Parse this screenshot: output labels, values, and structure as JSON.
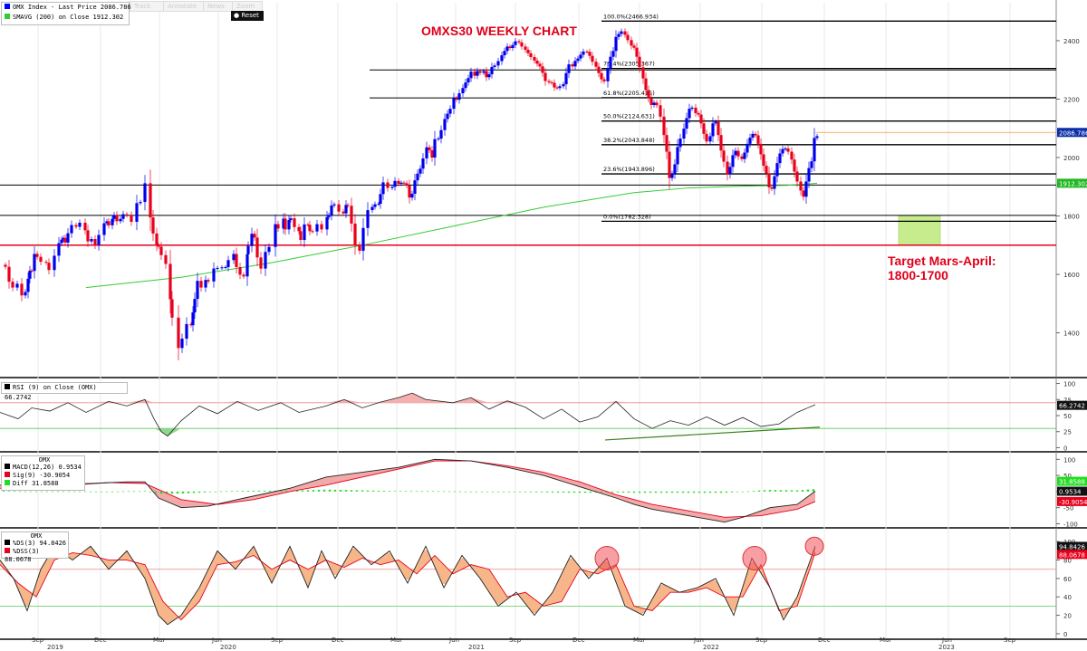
{
  "toolbar": {
    "track_label": "Track",
    "annotate_label": "Annotate",
    "news_label": "News",
    "zoom_label": "Zoom",
    "reset_label": "Reset"
  },
  "legend": {
    "price_label": "OMX Index - Last Price 2086.786",
    "smavg_label": "SMAVG (200)  on Close  1912.302",
    "price_color": "#0000ff",
    "smavg_color": "#33cc33"
  },
  "title": "OMXS30 WEEKLY CHART",
  "target_text": [
    "Target Mars-April:",
    "1800-1700"
  ],
  "colors": {
    "up": "#0000ee",
    "down": "#e8001c",
    "sma": "#33cc33",
    "hline_red": "#e8001c",
    "rsi": "#222222",
    "accent_red": "#e8001c",
    "target_box": "#c6ec8e"
  },
  "x_axis": {
    "months": [
      "Sep",
      "Dec",
      "Mar",
      "Jun",
      "Sep",
      "Dec",
      "Mar",
      "Jun",
      "Sep",
      "Dec",
      "Mar",
      "Jun",
      "Sep",
      "Dec",
      "Mar",
      "Jun",
      "Sep"
    ],
    "years": [
      "2019",
      "2020",
      "2021",
      "2022",
      "2023"
    ]
  },
  "chart_data": [
    {
      "type": "candlestick",
      "title": "OMXS30 WEEKLY CHART",
      "ylim": [
        1250,
        2530
      ],
      "y_ticks": [
        1400,
        1600,
        1800,
        2000,
        2200,
        2400
      ],
      "last_price_label": "2086.786",
      "sma_last_label": "1912.302",
      "price_path_x": [
        0,
        6,
        10,
        14,
        19,
        24,
        28,
        31,
        33,
        35,
        38,
        41,
        45,
        51,
        54,
        60,
        65,
        68,
        70,
        72,
        75,
        79,
        84,
        88,
        94,
        97,
        101,
        105,
        109,
        115,
        118,
        120,
        124,
        126,
        129,
        133,
        136,
        140,
        145,
        151,
        155,
        160,
        166,
        169,
        173,
        175,
        178,
        183,
        188,
        190,
        197,
        201,
        206,
        211,
        213,
        215,
        218,
        222,
        227,
        230,
        236,
        240,
        245,
        249,
        252,
        258,
        261,
        265,
        269,
        273,
        274,
        278,
        281,
        284,
        288,
        293,
        297,
        304,
        307,
        313,
        315,
        319,
        321,
        325,
        330,
        332,
        336,
        340,
        342,
        345,
        350,
        355,
        361,
        363,
        366,
        369,
        374,
        379,
        382,
        384,
        388,
        392,
        397,
        401,
        406,
        411,
        414,
        418,
        420,
        423,
        428,
        433,
        436,
        440,
        443,
        446,
        449,
        452,
        455,
        458,
        461,
        464,
        467,
        471,
        474,
        477,
        480,
        484,
        487,
        491,
        494,
        497,
        501,
        504,
        507,
        511,
        514,
        517,
        520,
        524,
        527,
        530,
        534,
        537,
        540,
        543,
        546,
        550,
        554,
        557,
        560,
        563,
        566,
        569,
        573,
        576,
        580,
        583,
        586,
        590,
        593,
        596,
        599,
        602,
        606,
        609,
        612,
        615,
        618,
        622,
        625,
        628,
        632,
        635,
        638,
        641,
        644,
        648,
        651,
        654,
        658,
        661,
        664,
        667,
        671,
        674,
        677,
        680,
        683,
        686,
        690,
        693,
        697,
        700,
        703,
        706,
        710,
        713,
        716,
        719,
        722,
        725,
        729,
        733,
        736,
        739,
        742,
        745,
        748,
        751,
        755,
        758,
        761,
        764,
        768,
        771,
        774,
        777,
        780,
        784,
        787,
        790,
        793,
        796,
        799,
        803,
        806,
        809,
        812,
        815,
        819,
        822,
        825,
        828,
        831,
        834,
        837,
        840,
        843,
        846,
        849,
        852,
        855,
        858,
        861,
        864,
        867,
        870,
        874,
        877,
        880,
        884,
        887,
        890,
        893,
        896,
        899,
        902
      ],
      "price_path_y": [
        1633,
        1626,
        1575,
        1555,
        1568,
        1528,
        1540,
        1585,
        1613,
        1612,
        1670,
        1660,
        1643,
        1640,
        1615,
        1664,
        1707,
        1719,
        1725,
        1709,
        1741,
        1769,
        1763,
        1777,
        1751,
        1713,
        1721,
        1700,
        1735,
        1775,
        1782,
        1768,
        1790,
        1803,
        1782,
        1790,
        1806,
        1802,
        1780,
        1844,
        1848,
        1912,
        1795,
        1740,
        1700,
        1695,
        1666,
        1636,
        1515,
        1452,
        1348,
        1380,
        1430,
        1426,
        1470,
        1516,
        1578,
        1555,
        1581,
        1576,
        1620,
        1622,
        1624,
        1625,
        1649,
        1670,
        1625,
        1599,
        1593,
        1669,
        1697,
        1739,
        1726,
        1658,
        1620,
        1677,
        1694,
        1772,
        1757,
        1791,
        1754,
        1786,
        1792,
        1762,
        1748,
        1718,
        1771,
        1770,
        1748,
        1747,
        1772,
        1754,
        1796,
        1803,
        1836,
        1840,
        1815,
        1809,
        1838,
        1835,
        1774,
        1699,
        1681,
        1759,
        1820,
        1831,
        1840,
        1842,
        1875,
        1915,
        1896,
        1900,
        1920,
        1910,
        1914,
        1912,
        1904,
        1863,
        1876,
        1922,
        1945,
        1962,
        1997,
        2035,
        2025,
        2000,
        2063,
        2065,
        2094,
        2132,
        2150,
        2167,
        2203,
        2198,
        2220,
        2238,
        2257,
        2272,
        2294,
        2280,
        2296,
        2290,
        2296,
        2275,
        2285,
        2310,
        2315,
        2330,
        2350,
        2365,
        2380,
        2375,
        2385,
        2398,
        2394,
        2380,
        2369,
        2357,
        2344,
        2332,
        2321,
        2312,
        2290,
        2262,
        2258,
        2256,
        2240,
        2238,
        2244,
        2251,
        2289,
        2319,
        2312,
        2331,
        2339,
        2352,
        2363,
        2362,
        2348,
        2328,
        2311,
        2289,
        2268,
        2261,
        2306,
        2345,
        2365,
        2413,
        2423,
        2432,
        2420,
        2402,
        2383,
        2376,
        2345,
        2309,
        2271,
        2231,
        2204,
        2180,
        2188,
        2179,
        2140,
        2077,
        2020,
        1930,
        1944,
        1977,
        2036,
        2065,
        2099,
        2135,
        2167,
        2171,
        2152,
        2147,
        2117,
        2081,
        2055,
        2073,
        2117,
        2122,
        2077,
        2024,
        1986,
        1943,
        1968,
        2008,
        2023,
        2004,
        1995,
        2017,
        2047,
        2068,
        2081,
        2076,
        2047,
        2011,
        1972,
        1946,
        1898,
        1893,
        1936,
        1981,
        2014,
        2029,
        2031,
        2020,
        1993,
        1952,
        1918,
        1887,
        1866,
        1918,
        1964,
        1987,
        2067,
        2073,
        2083,
        2097,
        2086
      ],
      "sma_x": [
        95,
        200,
        300,
        400,
        500,
        600,
        700,
        760,
        820,
        870,
        902
      ],
      "sma_y": [
        1555,
        1590,
        1640,
        1700,
        1765,
        1830,
        1880,
        1896,
        1902,
        1905,
        1912
      ],
      "horizontal_lines": [
        {
          "value": 1906,
          "color": "#000000"
        },
        {
          "value": 1802,
          "color": "#000000"
        },
        {
          "value": 1700,
          "color": "#e8001c"
        },
        {
          "value": 2300,
          "color": "#000000"
        },
        {
          "value": 2204,
          "color": "#000000"
        },
        {
          "value": 2086,
          "color": "#ff9933"
        }
      ],
      "fibonacci": [
        {
          "label": "100.0%(2466.934)",
          "value": 2467
        },
        {
          "label": "76.4%(2305.367)",
          "value": 2305
        },
        {
          "label": "61.8%(2205.415)",
          "value": 2205
        },
        {
          "label": "50.0%(2124.631)",
          "value": 2125
        },
        {
          "label": "38.2%(2043.848)",
          "value": 2044
        },
        {
          "label": "23.6%(1943.896)",
          "value": 1944
        },
        {
          "label": "0.0%(1782.328)",
          "value": 1782
        }
      ],
      "target_zone": {
        "y0": 1700,
        "y1": 1800
      }
    },
    {
      "type": "line",
      "title": "RSI (9)  on Close (OMX) 66.2742",
      "ylim": [
        -5,
        105
      ],
      "y_ticks": [
        0,
        25,
        50,
        75,
        100
      ],
      "last_label": "66.2742",
      "series": [
        {
          "x": [
            0,
            20,
            35,
            55,
            75,
            95,
            120,
            140,
            160,
            170,
            178,
            185,
            200,
            220,
            240,
            262,
            285,
            310,
            330,
            360,
            380,
            400,
            420,
            440,
            455,
            470,
            500,
            520,
            540,
            560,
            580,
            600,
            620,
            640,
            660,
            680,
            700,
            720,
            740,
            760,
            780,
            800,
            820,
            840,
            860,
            880,
            900
          ],
          "y": [
            55,
            45,
            62,
            57,
            70,
            55,
            72,
            65,
            75,
            45,
            25,
            18,
            42,
            65,
            53,
            72,
            58,
            70,
            55,
            65,
            75,
            62,
            71,
            78,
            85,
            75,
            70,
            78,
            60,
            73,
            63,
            45,
            60,
            40,
            48,
            72,
            45,
            30,
            42,
            35,
            48,
            35,
            47,
            33,
            37,
            55,
            67
          ]
        }
      ],
      "reference_lines": [
        70,
        30
      ]
    },
    {
      "type": "bar+line",
      "title": "OMX",
      "ylim": [
        -110,
        115
      ],
      "y_ticks": [
        -100,
        -50,
        0,
        50,
        100
      ],
      "series": [
        {
          "name": "MACD(12,26)",
          "value_label": "0.9534"
        },
        {
          "name": "Sig(9)",
          "value_label": "-30.9054"
        },
        {
          "name": "Diff",
          "value_label": "31.8588"
        }
      ],
      "macd_x": [
        0,
        30,
        60,
        100,
        140,
        160,
        175,
        200,
        230,
        270,
        320,
        360,
        400,
        440,
        480,
        520,
        560,
        600,
        640,
        680,
        700,
        720,
        760,
        800,
        820,
        850,
        880,
        900
      ],
      "macd_y": [
        20,
        15,
        20,
        25,
        30,
        30,
        -20,
        -50,
        -45,
        -20,
        10,
        45,
        60,
        75,
        100,
        95,
        75,
        50,
        15,
        -20,
        -40,
        -55,
        -75,
        -95,
        -80,
        -50,
        -40,
        1
      ],
      "sig_x": [
        0,
        40,
        80,
        120,
        160,
        200,
        240,
        280,
        320,
        360,
        400,
        440,
        480,
        520,
        560,
        600,
        640,
        680,
        720,
        760,
        800,
        840,
        880,
        900
      ],
      "sig_y": [
        10,
        15,
        20,
        28,
        25,
        -25,
        -40,
        -25,
        0,
        20,
        45,
        70,
        95,
        95,
        80,
        60,
        30,
        -10,
        -40,
        -60,
        -80,
        -75,
        -55,
        -31
      ]
    },
    {
      "type": "line",
      "title": "OMX",
      "ylim": [
        -5,
        112
      ],
      "y_ticks": [
        0,
        20,
        40,
        60,
        80,
        100
      ],
      "series": [
        {
          "name": "%DS(3)",
          "value_label": "94.8426"
        },
        {
          "name": "%DSS(3)",
          "value_label": "88.0678"
        }
      ],
      "ds_x": [
        0,
        15,
        30,
        45,
        60,
        80,
        100,
        120,
        140,
        160,
        175,
        185,
        200,
        220,
        240,
        260,
        280,
        300,
        320,
        340,
        355,
        370,
        390,
        410,
        430,
        450,
        470,
        490,
        510,
        530,
        550,
        570,
        590,
        610,
        630,
        650,
        670,
        690,
        710,
        730,
        750,
        770,
        790,
        810,
        830,
        850,
        865,
        880,
        900
      ],
      "ds_y": [
        80,
        60,
        25,
        70,
        95,
        80,
        95,
        70,
        90,
        60,
        20,
        10,
        20,
        50,
        90,
        70,
        95,
        55,
        95,
        50,
        90,
        60,
        95,
        75,
        90,
        55,
        95,
        50,
        85,
        60,
        30,
        45,
        20,
        45,
        85,
        60,
        82,
        30,
        20,
        55,
        45,
        50,
        60,
        20,
        82,
        50,
        15,
        40,
        95
      ],
      "dss_x": [
        0,
        20,
        40,
        60,
        80,
        100,
        120,
        140,
        160,
        180,
        200,
        220,
        240,
        260,
        280,
        300,
        320,
        340,
        360,
        380,
        400,
        420,
        440,
        460,
        480,
        500,
        520,
        540,
        560,
        580,
        600,
        620,
        640,
        660,
        680,
        700,
        720,
        740,
        760,
        780,
        800,
        820,
        840,
        860,
        880,
        900
      ],
      "dss_y": [
        75,
        55,
        40,
        80,
        88,
        85,
        80,
        80,
        75,
        35,
        15,
        35,
        75,
        78,
        85,
        70,
        80,
        70,
        80,
        72,
        82,
        75,
        80,
        65,
        85,
        65,
        75,
        70,
        40,
        45,
        30,
        35,
        70,
        65,
        75,
        30,
        25,
        45,
        45,
        50,
        40,
        40,
        75,
        25,
        30,
        88
      ],
      "reference_lines": [
        70,
        30
      ],
      "highlight_circles": [
        {
          "x": 670,
          "y": 82
        },
        {
          "x": 833,
          "y": 82
        },
        {
          "x": 899,
          "y": 95
        }
      ]
    }
  ]
}
